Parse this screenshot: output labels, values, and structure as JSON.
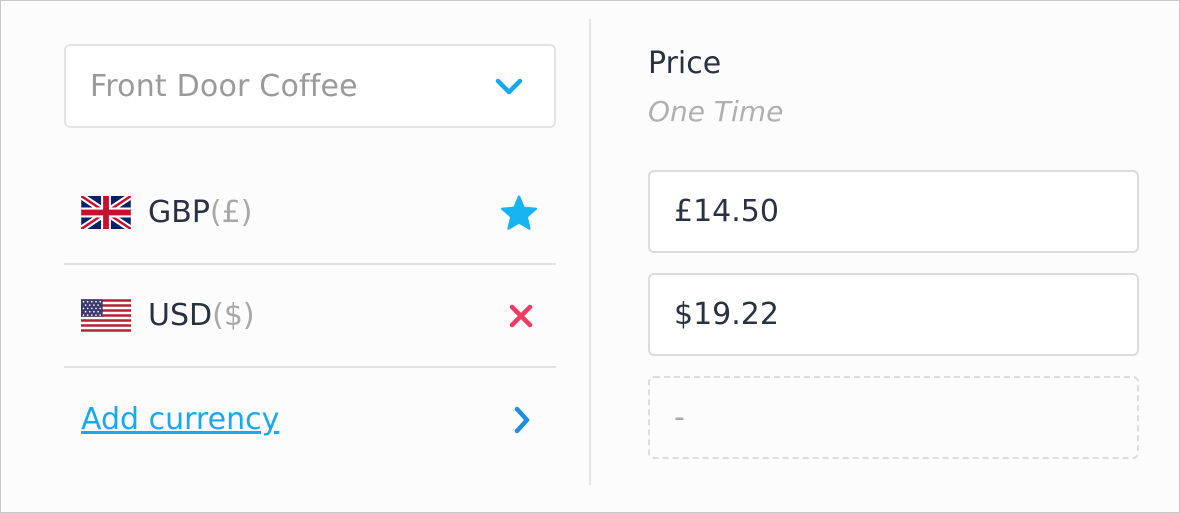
{
  "product_select": {
    "value": "Front Door Coffee"
  },
  "currencies": [
    {
      "code": "GBP",
      "symbol": "(£)",
      "flag": "uk-flag-icon",
      "action_icon": "star-icon",
      "action_color": "#16b4f2"
    },
    {
      "code": "USD",
      "symbol": "($)",
      "flag": "us-flag-icon",
      "action_icon": "close-icon",
      "action_color": "#f03a62"
    }
  ],
  "add_currency": {
    "label": "Add currency"
  },
  "price": {
    "title": "Price",
    "subtitle": "One Time",
    "fields": [
      {
        "value": "£14.50"
      },
      {
        "value": "$19.22"
      },
      {
        "placeholder": "-"
      }
    ]
  },
  "colors": {
    "accent": "#1ba8f0",
    "remove": "#f03a62",
    "star": "#16b4f2"
  }
}
